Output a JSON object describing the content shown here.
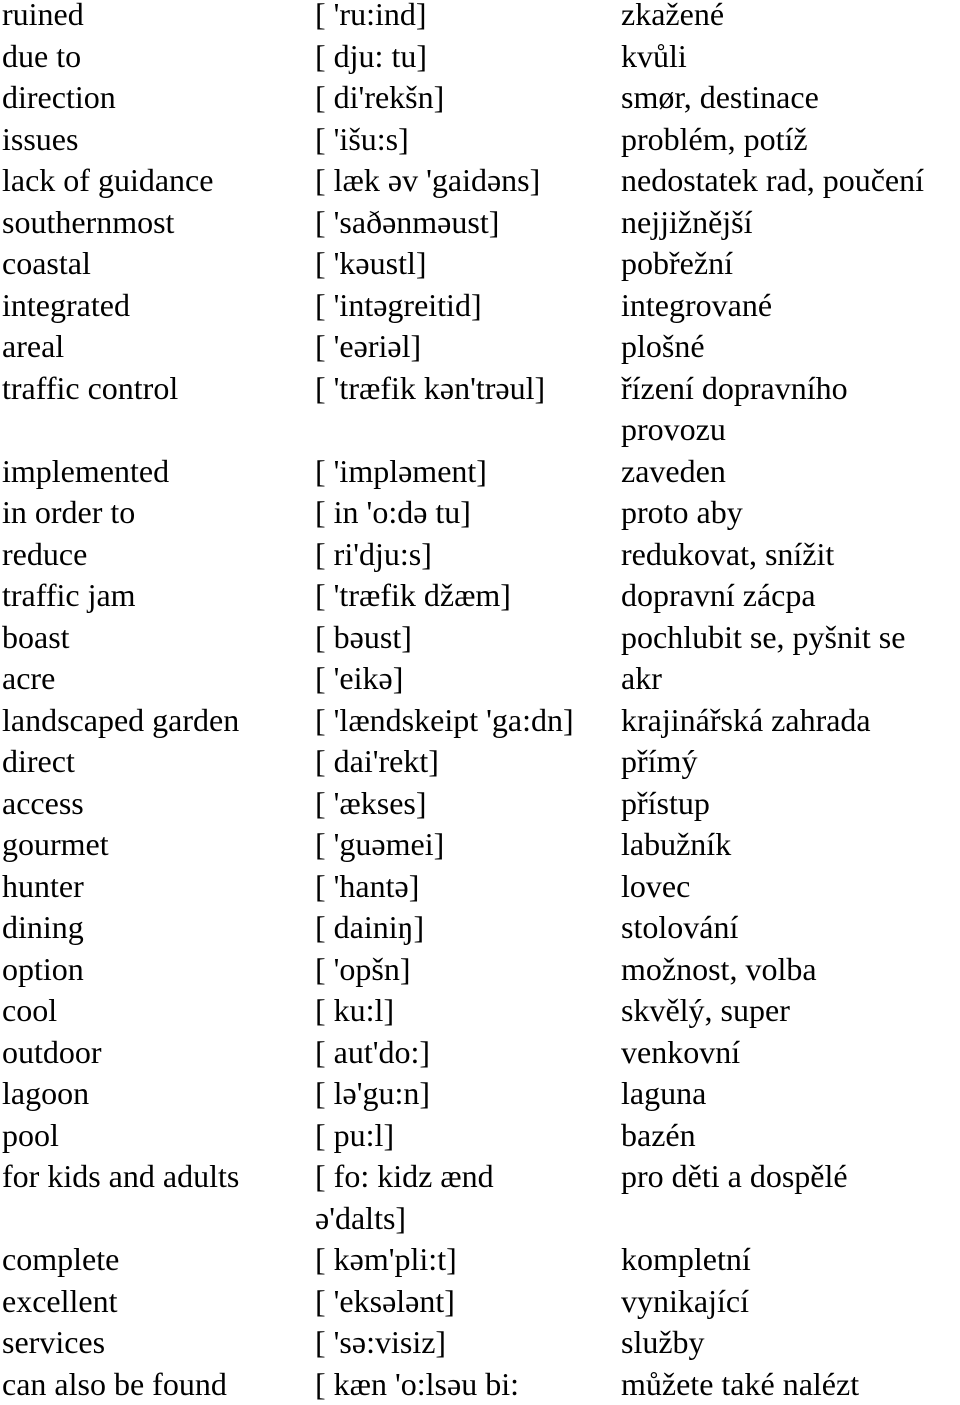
{
  "vocabulary": [
    {
      "english": "ruined",
      "ipa": [
        "[ 'ru:ind]"
      ],
      "czech": [
        "zkažené"
      ]
    },
    {
      "english": "due to",
      "ipa": [
        "[ dju: tu]"
      ],
      "czech": [
        "kvůli"
      ]
    },
    {
      "english": "direction",
      "ipa": [
        "[ di'rekšn]"
      ],
      "czech": [
        "smør, destinace"
      ]
    },
    {
      "english": "issues",
      "ipa": [
        "[ 'išu:s]"
      ],
      "czech": [
        "problém, potíž"
      ]
    },
    {
      "english": "lack of guidance",
      "ipa": [
        "[ læk əv 'gaidəns]"
      ],
      "czech": [
        "nedostatek rad, poučení"
      ]
    },
    {
      "english": "southernmost",
      "ipa": [
        "[ 'saðənməust]"
      ],
      "czech": [
        "nejjižnější"
      ]
    },
    {
      "english": "coastal",
      "ipa": [
        "[ 'kəustl]"
      ],
      "czech": [
        "pobřežní"
      ]
    },
    {
      "english": "integrated",
      "ipa": [
        "[ 'intəgreitid]"
      ],
      "czech": [
        "integrované"
      ]
    },
    {
      "english": "areal",
      "ipa": [
        "[ 'eəriəl]"
      ],
      "czech": [
        "plošné"
      ]
    },
    {
      "english": "traffic control",
      "ipa": [
        "[ 'træfik kən'trəul]"
      ],
      "czech": [
        "řízení dopravního",
        "provozu"
      ]
    },
    {
      "english": "implemented",
      "ipa": [
        "[ 'impləment]"
      ],
      "czech": [
        "zaveden"
      ]
    },
    {
      "english": "in order to",
      "ipa": [
        "[ in 'o:də tu]"
      ],
      "czech": [
        "proto aby"
      ]
    },
    {
      "english": "reduce",
      "ipa": [
        "[ ri'dju:s]"
      ],
      "czech": [
        "redukovat, snížit"
      ]
    },
    {
      "english": "traffic jam",
      "ipa": [
        "[ 'træfik džæm]"
      ],
      "czech": [
        "dopravní zácpa"
      ]
    },
    {
      "english": "boast",
      "ipa": [
        "[ bəust]"
      ],
      "czech": [
        "pochlubit se, pyšnit se"
      ]
    },
    {
      "english": "acre",
      "ipa": [
        "[ 'eikə]"
      ],
      "czech": [
        "akr"
      ]
    },
    {
      "english": "landscaped garden",
      "ipa": [
        "[ 'lændskeipt 'ga:dn]"
      ],
      "czech": [
        "krajinářská zahrada"
      ]
    },
    {
      "english": "direct",
      "ipa": [
        "[ dai'rekt]"
      ],
      "czech": [
        "přímý"
      ]
    },
    {
      "english": "access",
      "ipa": [
        "[ 'ækses]"
      ],
      "czech": [
        "přístup"
      ]
    },
    {
      "english": "gourmet",
      "ipa": [
        "[ 'guəmei]"
      ],
      "czech": [
        "labužník"
      ]
    },
    {
      "english": "hunter",
      "ipa": [
        "[ 'hantə]"
      ],
      "czech": [
        "lovec"
      ]
    },
    {
      "english": "dining",
      "ipa": [
        "[ dainiŋ]"
      ],
      "czech": [
        "stolování"
      ]
    },
    {
      "english": "option",
      "ipa": [
        "[ 'opšn]"
      ],
      "czech": [
        "možnost, volba"
      ]
    },
    {
      "english": "cool",
      "ipa": [
        "[ ku:l]"
      ],
      "czech": [
        "skvělý, super"
      ]
    },
    {
      "english": "outdoor",
      "ipa": [
        "[ aut'do:]"
      ],
      "czech": [
        "venkovní"
      ]
    },
    {
      "english": "lagoon",
      "ipa": [
        "[ lə'gu:n]"
      ],
      "czech": [
        "laguna"
      ]
    },
    {
      "english": "pool",
      "ipa": [
        "[ pu:l]"
      ],
      "czech": [
        "bazén"
      ]
    },
    {
      "english": "for kids and adults",
      "ipa": [
        "[ fo: kidz ænd",
        "ə'dalts]"
      ],
      "czech": [
        "pro děti a dospělé"
      ]
    },
    {
      "english": "complete",
      "ipa": [
        "[ kəm'pli:t]"
      ],
      "czech": [
        "kompletní"
      ]
    },
    {
      "english": "excellent",
      "ipa": [
        "[ 'eksələnt]"
      ],
      "czech": [
        "vynikající"
      ]
    },
    {
      "english": "services",
      "ipa": [
        "[ 'sə:visiz]"
      ],
      "czech": [
        "služby"
      ]
    },
    {
      "english": "can also be found",
      "ipa": [
        "[ kæn 'o:lsəu bi:"
      ],
      "czech": [
        "můžete také nalézt"
      ]
    }
  ]
}
